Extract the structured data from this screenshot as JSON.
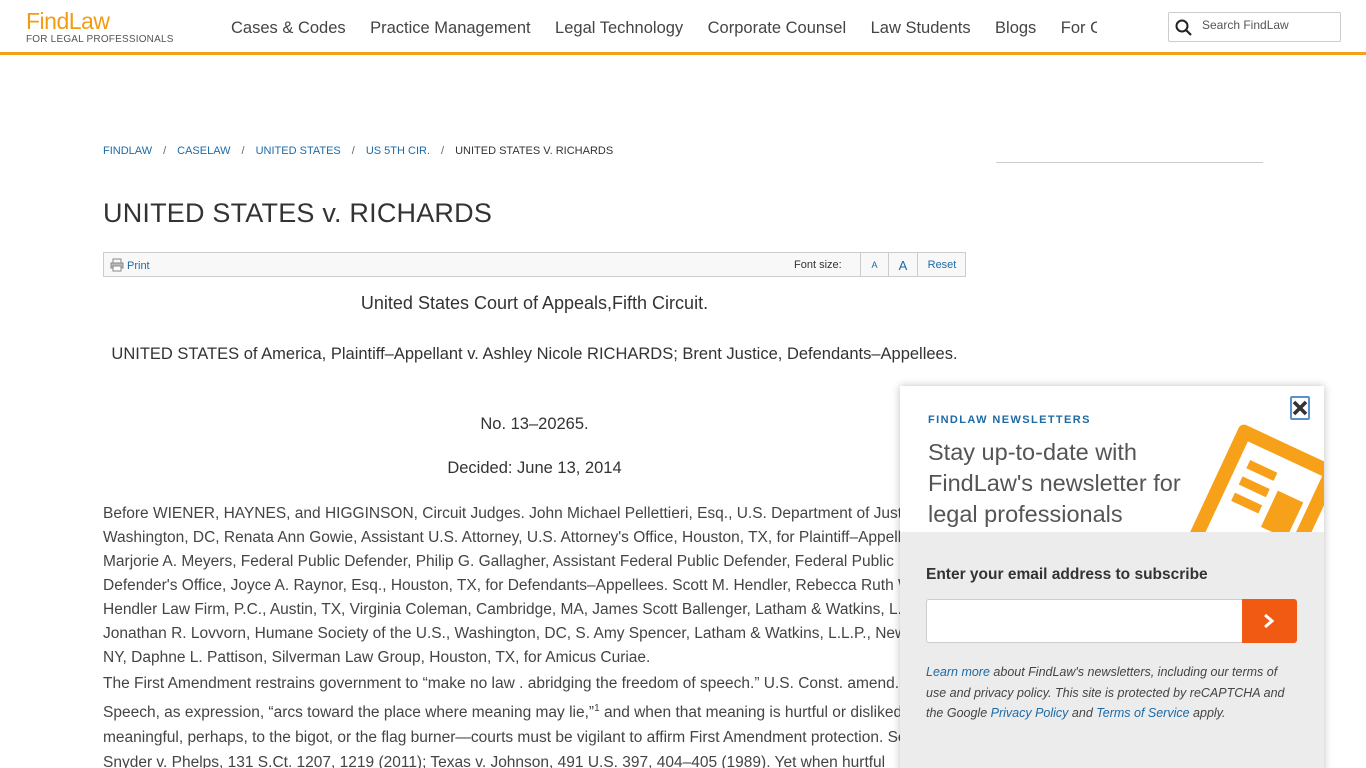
{
  "header": {
    "logo_text": "FindLaw",
    "logo_tagline": "FOR LEGAL PROFESSIONALS",
    "nav": [
      "Cases & Codes",
      "Practice Management",
      "Legal Technology",
      "Corporate Counsel",
      "Law Students",
      "Blogs",
      "For Consumers"
    ],
    "search_placeholder": "Search FindLaw"
  },
  "breadcrumb": {
    "items": [
      "FINDLAW",
      "CASELAW",
      "UNITED STATES",
      "US 5TH CIR."
    ],
    "current": "UNITED STATES V. RICHARDS",
    "separator": "/"
  },
  "page_title": "UNITED STATES v. RICHARDS",
  "toolbar": {
    "print_label": "Print",
    "font_size_label": "Font size:",
    "small_label": "A",
    "large_label": "A",
    "reset_label": "Reset"
  },
  "opinion": {
    "court": "United States Court of Appeals,Fifth Circuit.",
    "parties": "UNITED STATES of America, Plaintiff–Appellant v. Ashley Nicole RICHARDS; Brent Justice, Defendants–Appellees.",
    "docket": "No. 13–20265.",
    "decided": "Decided: June 13, 2014",
    "counsel": "Before WIENER, HAYNES, and HIGGINSON, Circuit Judges. John Michael Pellettieri, Esq., U.S. Department of Justice, Washington, DC, Renata Ann Gowie, Assistant U.S. Attorney, U.S. Attorney's Office, Houston, TX, for Plaintiff–Appellant. Marjorie A. Meyers, Federal Public Defender, Philip G. Gallagher, Assistant Federal Public Defender, Federal Public Defender's Office, Joyce A. Raynor, Esq., Houston, TX, for Defendants–Appellees. Scott M. Hendler, Rebecca Ruth Webber, Hendler Law Firm, P.C., Austin, TX, Virginia Coleman, Cambridge, MA, James Scott Ballenger, Latham & Watkins, L.L.P., Jonathan R. Lovvorn, Humane Society of the U.S., Washington, DC, S. Amy Spencer, Latham & Watkins, L.L.P., New York, NY, Daphne L. Pattison, Silverman Law Group, Houston, TX, for Amicus Curiae.",
    "body_part1": "The First Amendment restrains government to “make no law . abridging the freedom of speech.” U.S. Const. amend. I. Speech, as expression, “arcs toward the place where meaning may lie,”",
    "footnote_mark": "1",
    "body_part2": " and when that meaning is hurtful or disliked, yet meaningful, perhaps, to the bigot, or the flag burner—courts must be vigilant to affirm First Amendment protection. See Snyder v. Phelps, 131 S.Ct. 1207, 1219 (2011); Texas v. Johnson, 491 U.S. 397, 404–405 (1989). Yet when hurtful"
  },
  "newsletter": {
    "kicker": "FINDLAW NEWSLETTERS",
    "heading": "Stay up-to-date with FindLaw's newsletter for legal professionals",
    "email_label": "Enter your email address to subscribe",
    "fine_link1": "Learn more",
    "fine_text1": " about FindLaw's newsletters, including our terms of use and privacy policy. This site is protected by reCAPTCHA and the Google ",
    "fine_link2": "Privacy Policy",
    "fine_text2": " and ",
    "fine_link3": "Terms of Service",
    "fine_text3": " apply."
  },
  "colors": {
    "brand_orange": "#f39c12",
    "link_blue": "#1d6aa5",
    "submit_orange": "#f05a13"
  }
}
